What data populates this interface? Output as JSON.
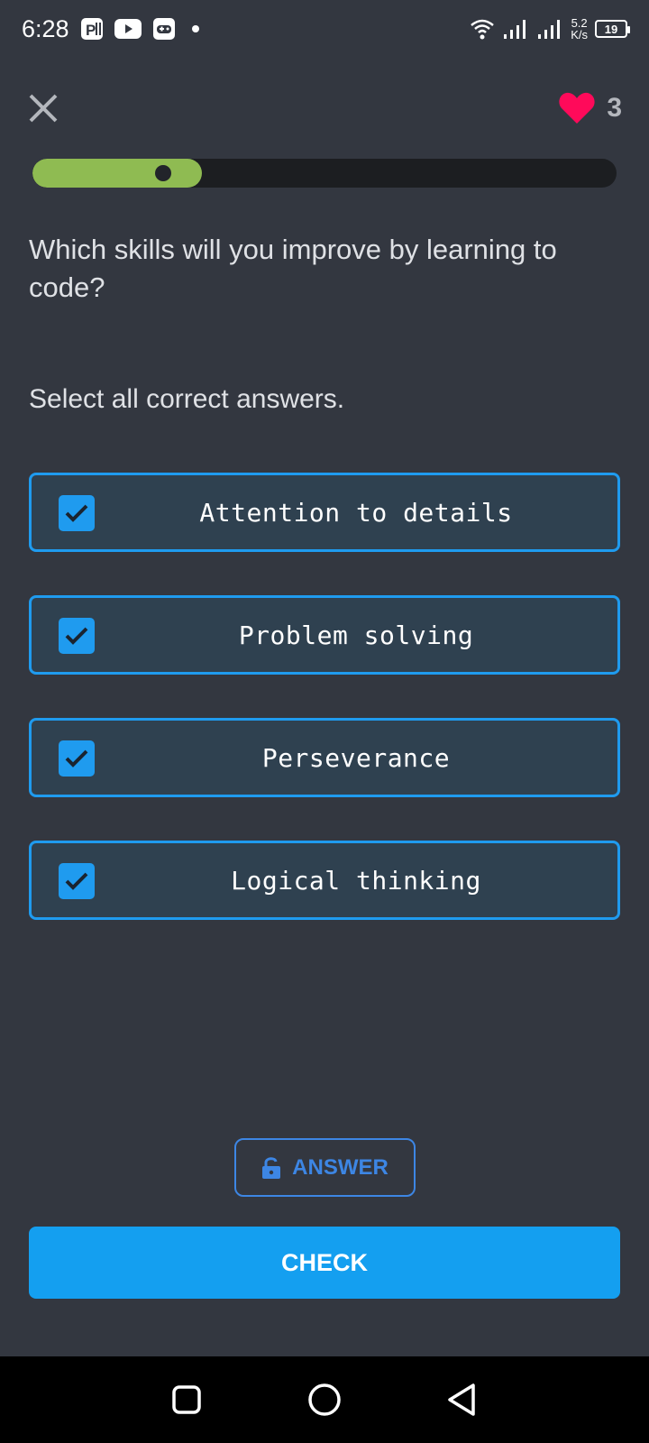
{
  "status_bar": {
    "time": "6:28",
    "net_speed_value": "5.2",
    "net_speed_unit": "K/s",
    "battery": "19",
    "icons": [
      "parking-app-icon",
      "youtube-icon",
      "game-controller-icon",
      "dot-icon",
      "wifi-icon",
      "signal-icon",
      "signal-icon",
      "battery-icon"
    ]
  },
  "header": {
    "close_icon": "close-icon",
    "lives_icon": "heart-icon",
    "lives_count": "3",
    "lives_color": "#ff0a5a"
  },
  "progress": {
    "value": 0.29,
    "fill_color": "#8fbb52"
  },
  "question": {
    "text": "Which skills will you improve by learning to code?",
    "instruction": "Select all correct answers."
  },
  "options": [
    {
      "label": "Attention to details",
      "checked": true
    },
    {
      "label": "Problem solving",
      "checked": true
    },
    {
      "label": "Perseverance",
      "checked": true
    },
    {
      "label": "Logical thinking",
      "checked": true
    }
  ],
  "buttons": {
    "answer_label": "ANSWER",
    "answer_icon": "unlock-icon",
    "check_label": "CHECK",
    "accent": "#1f9bef"
  },
  "nav_bar": {
    "icons": [
      "recents-square-icon",
      "home-circle-icon",
      "back-triangle-icon"
    ]
  }
}
